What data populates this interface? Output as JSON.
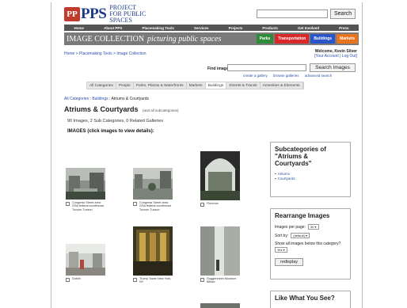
{
  "header": {
    "logo_mark": "PP",
    "logo_word": "PPS",
    "logo_tagline": "Project for Public Spaces",
    "search_button": "Search"
  },
  "nav": [
    "Home",
    "About PPS",
    "Placemaking Tools",
    "Services",
    "Projects",
    "Products",
    "Get Involved",
    "Press"
  ],
  "banner": {
    "title": "IMAGE COLLECTION",
    "subtitle": "picturing public spaces",
    "tabs": [
      {
        "label": "Parks",
        "color": "#2e8b3a"
      },
      {
        "label": "Transportation",
        "color": "#d8282a"
      },
      {
        "label": "Buildings",
        "color": "#2a55c8"
      },
      {
        "label": "Markets",
        "color": "#e8751e"
      }
    ]
  },
  "breadcrumb": "Home > Placemaking Tools > Image Collection",
  "user": {
    "welcome": "Welcome, Kevin Silver",
    "links": "[Your Account | Log Out]"
  },
  "find": {
    "label": "Find images:",
    "button": "Search Images",
    "link1": "create a gallery",
    "link2": "browse galleries",
    "link3": "advanced search"
  },
  "category_tabs": [
    "All Categories",
    "People",
    "Parks, Plazas & Waterfronts",
    "Markets",
    "Buildings",
    "Streets & Transit",
    "Amenities & Elements"
  ],
  "sub_breadcrumb": {
    "link1": "All Categories",
    "link2": "Buildings",
    "current": "Atriums & Courtyards"
  },
  "page": {
    "title": "Atriums & Courtyards",
    "title_note": "(and all subcategories)",
    "counts": "90 Images, 2 Sub Categories, 0 Related Galleries",
    "images_label": "IMAGES (click images to view details):"
  },
  "thumbnails": [
    {
      "caption": "Congress Street area GSA federal courthouse Tucson Tucson"
    },
    {
      "caption": "Congress Street area GSA federal courthouse Tucson Tucson"
    },
    {
      "caption": "Florence"
    },
    {
      "caption": "Dublin"
    },
    {
      "caption": "Trump Tower New York, NY"
    },
    {
      "caption": "Guggenheim Museum Bilbao"
    }
  ],
  "subcategories": {
    "title": "Subcategories of \"Atriums & Courtyards\"",
    "items": [
      "Atriums",
      "Courtyards"
    ]
  },
  "rearrange": {
    "title": "Rearrange Images",
    "per_page_label": "Images per page:",
    "per_page_value": "30",
    "sort_label": "Sort by:",
    "sort_value": "(default)",
    "show_all_label": "Show all images below this category?",
    "show_all_value": "Yes",
    "button": "redisplay"
  },
  "promo": {
    "title": "Like What You See?"
  }
}
